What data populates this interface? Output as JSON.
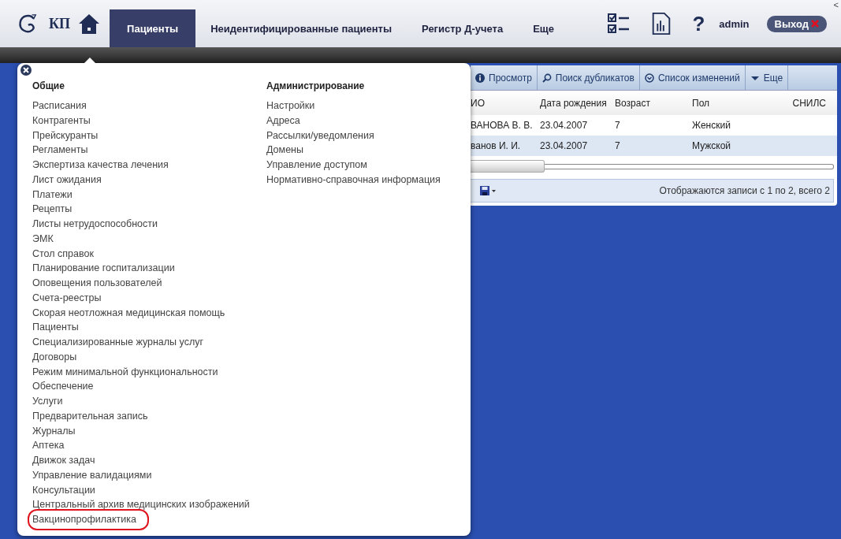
{
  "header": {
    "logo_text": "КП",
    "tabs": [
      {
        "label": "Пациенты",
        "selected": true
      },
      {
        "label": "Неидентифицированные пациенты",
        "selected": false
      },
      {
        "label": "Регистр Д-учета",
        "selected": false
      },
      {
        "label": "Еще",
        "selected": false
      }
    ],
    "help": "?",
    "user": "admin",
    "logout": "Выход",
    "corner_glyph": "<"
  },
  "panel": {
    "toolbar": [
      "Просмотр",
      "Поиск дубликатов",
      "Список изменений",
      "Еще"
    ],
    "columns": [
      "ИО",
      "Дата рождения",
      "Возраст",
      "Пол",
      "СНИЛС"
    ],
    "rows": [
      {
        "cells": [
          "ВАНОВА В. В.",
          "23.04.2007",
          "7",
          "Женский"
        ],
        "selected": false
      },
      {
        "cells": [
          "ванов И. И.",
          "23.04.2007",
          "7",
          "Мужской"
        ],
        "selected": true
      }
    ],
    "status": "Отображаются записи с 1 по 2, всего 2"
  },
  "menu": {
    "columns": [
      {
        "heading": "Общие",
        "items": [
          {
            "label": "Расписания",
            "highlighted": false
          },
          {
            "label": "Контрагенты",
            "highlighted": false
          },
          {
            "label": "Прейскуранты",
            "highlighted": false
          },
          {
            "label": "Регламенты",
            "highlighted": false
          },
          {
            "label": "Экспертиза качества лечения",
            "highlighted": false
          },
          {
            "label": "Лист ожидания",
            "highlighted": false
          },
          {
            "label": "Платежи",
            "highlighted": false
          },
          {
            "label": "Рецепты",
            "highlighted": false
          },
          {
            "label": "Листы нетрудоспособности",
            "highlighted": false
          },
          {
            "label": "ЭМК",
            "highlighted": false
          },
          {
            "label": "Стол справок",
            "highlighted": false
          },
          {
            "label": "Планирование госпитализации",
            "highlighted": false
          },
          {
            "label": "Оповещения пользователей",
            "highlighted": false
          },
          {
            "label": "Счета-реестры",
            "highlighted": false
          },
          {
            "label": "Скорая неотложная медицинская помощь",
            "highlighted": false
          },
          {
            "label": "Пациенты",
            "highlighted": false
          },
          {
            "label": "Специализированные журналы услуг",
            "highlighted": false
          },
          {
            "label": "Договоры",
            "highlighted": false
          },
          {
            "label": "Режим минимальной функциональности",
            "highlighted": false
          },
          {
            "label": "Обеспечение",
            "highlighted": false
          },
          {
            "label": "Услуги",
            "highlighted": false
          },
          {
            "label": "Предварительная запись",
            "highlighted": false
          },
          {
            "label": "Журналы",
            "highlighted": false
          },
          {
            "label": "Аптека",
            "highlighted": false
          },
          {
            "label": "Движок задач",
            "highlighted": false
          },
          {
            "label": "Управление валидациями",
            "highlighted": false
          },
          {
            "label": "Консультации",
            "highlighted": false
          },
          {
            "label": "Центральный архив медицинских изображений",
            "highlighted": false
          },
          {
            "label": "Вакцинопрофилактика",
            "highlighted": true
          }
        ]
      },
      {
        "heading": "Администрирование",
        "items": [
          {
            "label": "Настройки",
            "highlighted": false
          },
          {
            "label": "Адреса",
            "highlighted": false
          },
          {
            "label": "Рассылки/уведомления",
            "highlighted": false
          },
          {
            "label": "Домены",
            "highlighted": false
          },
          {
            "label": "Управление доступом",
            "highlighted": false
          },
          {
            "label": "Нормативно-справочная информация",
            "highlighted": false
          }
        ]
      }
    ]
  }
}
